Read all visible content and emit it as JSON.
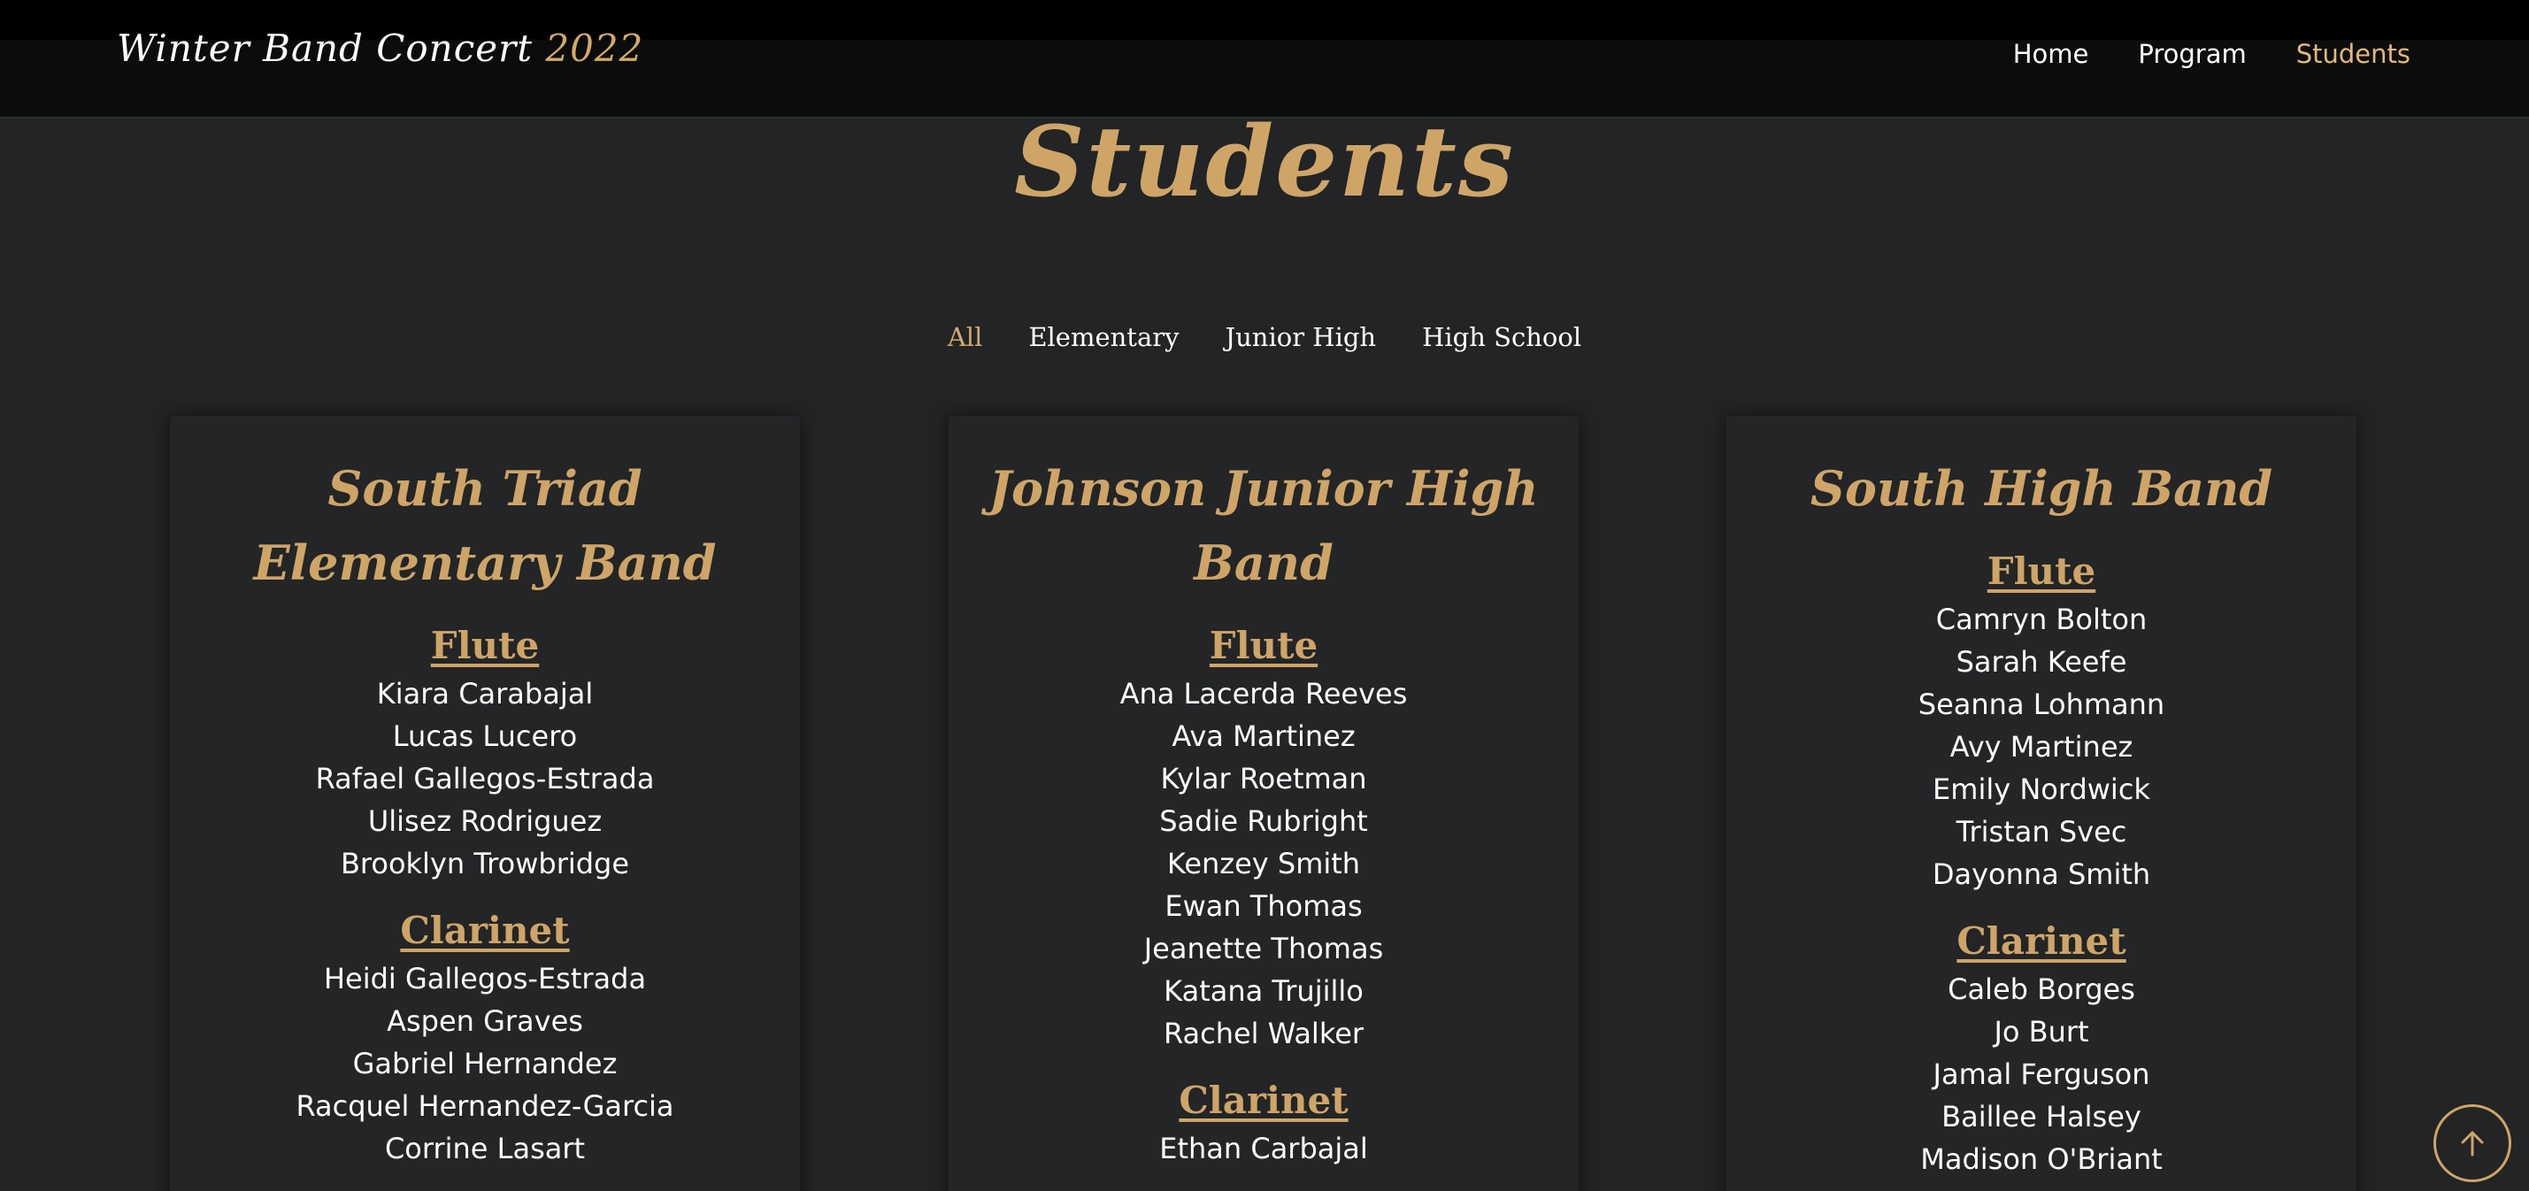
{
  "header": {
    "brand_title": "Winter Band Concert",
    "brand_year": "2022",
    "nav": [
      {
        "label": "Home",
        "active": false
      },
      {
        "label": "Program",
        "active": false
      },
      {
        "label": "Students",
        "active": true
      }
    ]
  },
  "page_title": "Students",
  "filters": [
    {
      "label": "All",
      "active": true
    },
    {
      "label": "Elementary",
      "active": false
    },
    {
      "label": "Junior High",
      "active": false
    },
    {
      "label": "High School",
      "active": false
    }
  ],
  "bands": [
    {
      "title": "South Triad Elementary Band",
      "sections": [
        {
          "title": "Flute",
          "students": [
            "Kiara Carabajal",
            "Lucas Lucero",
            "Rafael Gallegos-Estrada",
            "Ulisez Rodriguez",
            "Brooklyn Trowbridge"
          ]
        },
        {
          "title": "Clarinet",
          "students": [
            "Heidi Gallegos-Estrada",
            "Aspen Graves",
            "Gabriel Hernandez",
            "Racquel Hernandez-Garcia",
            "Corrine Lasart"
          ]
        }
      ]
    },
    {
      "title": "Johnson Junior High Band",
      "sections": [
        {
          "title": "Flute",
          "students": [
            "Ana Lacerda Reeves",
            "Ava Martinez",
            "Kylar Roetman",
            "Sadie Rubright",
            "Kenzey Smith",
            "Ewan Thomas",
            "Jeanette Thomas",
            "Katana Trujillo",
            "Rachel Walker"
          ]
        },
        {
          "title": "Clarinet",
          "students": [
            "Ethan Carbajal"
          ]
        }
      ]
    },
    {
      "title": "South High Band",
      "sections": [
        {
          "title": "Flute",
          "students": [
            "Camryn Bolton",
            "Sarah Keefe",
            "Seanna Lohmann",
            "Avy Martinez",
            "Emily Nordwick",
            "Tristan Svec",
            "Dayonna Smith"
          ]
        },
        {
          "title": "Clarinet",
          "students": [
            "Caleb Borges",
            "Jo Burt",
            "Jamal Ferguson",
            "Baillee Halsey",
            "Madison O'Briant"
          ]
        }
      ]
    }
  ],
  "colors": {
    "accent": "#cea567",
    "background": "#222426",
    "header": "#0c0e0d"
  },
  "icons": {
    "back_to_top": "arrow-up-icon"
  }
}
